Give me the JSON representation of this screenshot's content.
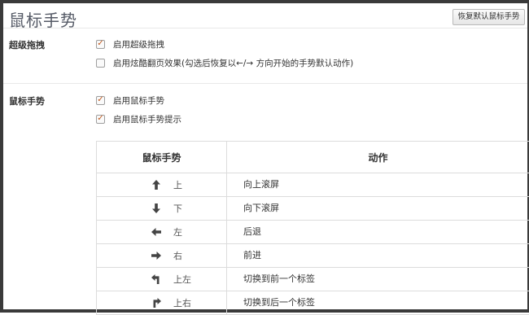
{
  "header": {
    "title": "鼠标手势",
    "reset_button": "恢复默认鼠标手势"
  },
  "super_drag": {
    "label": "超级拖拽",
    "options": [
      {
        "label": "启用超级拖拽",
        "checked": true
      },
      {
        "label": "启用炫酷翻页效果(勾选后恢复以←/→ 方向开始的手势默认动作)",
        "checked": false
      }
    ]
  },
  "mouse_gesture": {
    "label": "鼠标手势",
    "options": [
      {
        "label": "启用鼠标手势",
        "checked": true
      },
      {
        "label": "启用鼠标手势提示",
        "checked": true
      }
    ]
  },
  "table": {
    "headers": [
      "鼠标手势",
      "动作"
    ],
    "rows": [
      {
        "icon": "arrow-up-icon",
        "gesture": "上",
        "action": "向上滚屏"
      },
      {
        "icon": "arrow-down-icon",
        "gesture": "下",
        "action": "向下滚屏"
      },
      {
        "icon": "arrow-left-icon",
        "gesture": "左",
        "action": "后退"
      },
      {
        "icon": "arrow-right-icon",
        "gesture": "右",
        "action": "前进"
      },
      {
        "icon": "arrow-up-left-icon",
        "gesture": "上左",
        "action": "切换到前一个标签"
      },
      {
        "icon": "arrow-up-right-icon",
        "gesture": "上右",
        "action": "切换到后一个标签"
      }
    ]
  },
  "colors": {
    "check": "#c0581c",
    "title": "#555a66",
    "border": "#dcdcdc"
  }
}
